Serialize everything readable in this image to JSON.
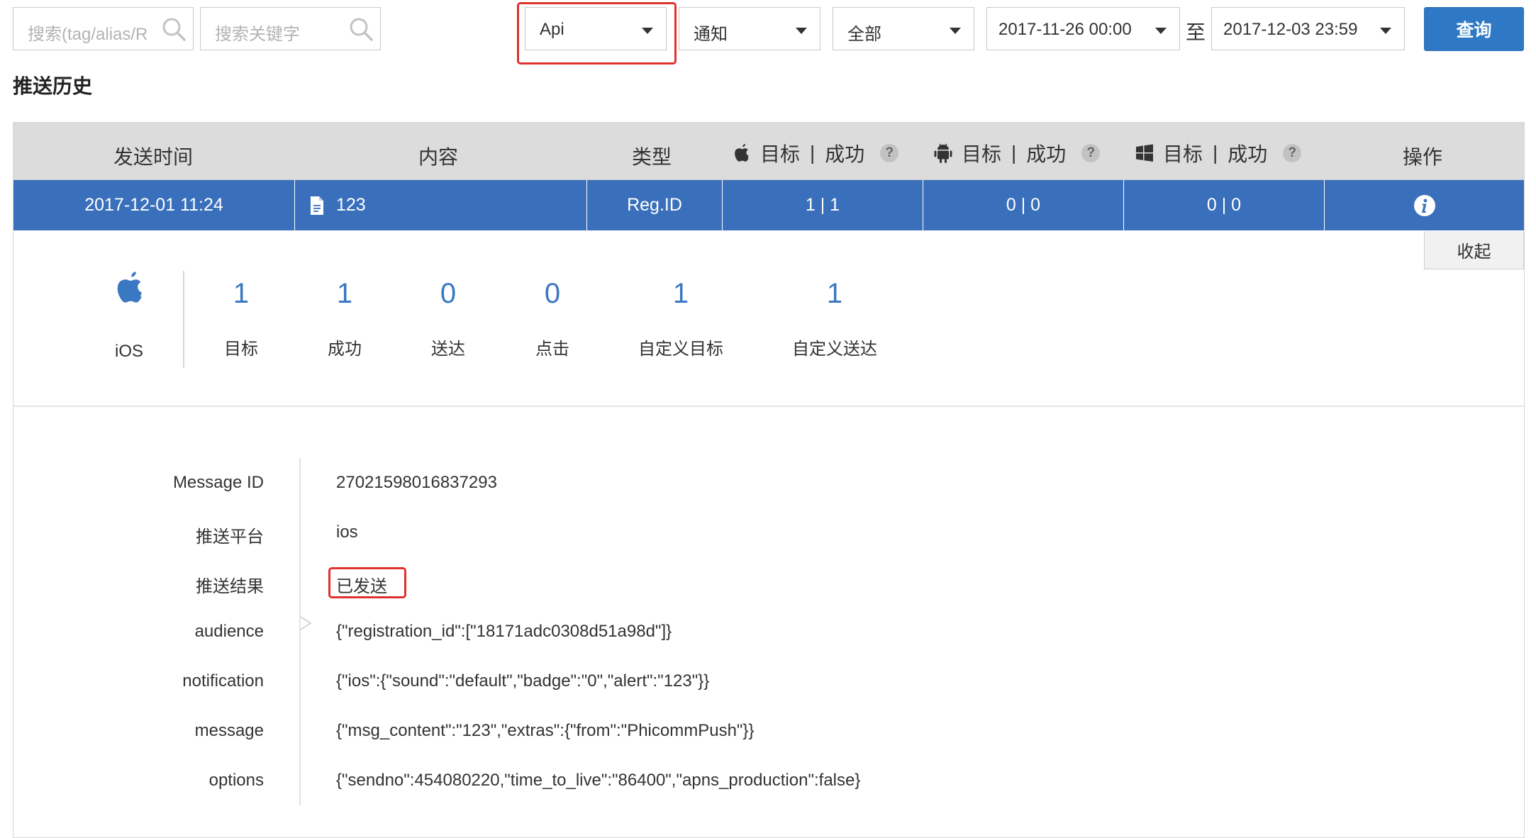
{
  "filters": {
    "search_tag_placeholder": "搜索(tag/alias/R",
    "search_keyword_placeholder": "搜索关键字",
    "source_select": "Api",
    "type_select": "通知",
    "scope_select": "全部",
    "start_time": "2017-11-26 00:00",
    "range_separator": "至",
    "end_time": "2017-12-03 23:59",
    "query_button": "查询"
  },
  "section_title": "推送历史",
  "table": {
    "headers": {
      "send_time": "发送时间",
      "content": "内容",
      "type": "类型",
      "target": "目标",
      "divider": "|",
      "success": "成功",
      "help": "?",
      "action": "操作"
    },
    "row": {
      "send_time": "2017-12-01 11:24",
      "content": "123",
      "type": "Reg.ID",
      "ios": "1 | 1",
      "android": "0 | 0",
      "windows": "0 | 0"
    },
    "collapse_button": "收起"
  },
  "stats": {
    "platform": "iOS",
    "items": [
      {
        "value": "1",
        "label": "目标"
      },
      {
        "value": "1",
        "label": "成功"
      },
      {
        "value": "0",
        "label": "送达"
      },
      {
        "value": "0",
        "label": "点击"
      },
      {
        "value": "1",
        "label": "自定义目标"
      },
      {
        "value": "1",
        "label": "自定义送达"
      }
    ]
  },
  "details": [
    {
      "label": "Message ID",
      "value": "27021598016837293"
    },
    {
      "label": "推送平台",
      "value": "ios"
    },
    {
      "label": "推送结果",
      "value": "已发送"
    },
    {
      "label": "audience",
      "value": "{\"registration_id\":[\"18171adc0308d51a98d\"]}"
    },
    {
      "label": "notification",
      "value": "{\"ios\":{\"sound\":\"default\",\"badge\":\"0\",\"alert\":\"123\"}}"
    },
    {
      "label": "message",
      "value": "{\"msg_content\":\"123\",\"extras\":{\"from\":\"PhicommPush\"}}"
    },
    {
      "label": "options",
      "value": "{\"sendno\":454080220,\"time_to_live\":\"86400\",\"apns_production\":false}"
    }
  ],
  "colors": {
    "accent": "#2f78c6",
    "selected_row": "#3a70bb",
    "highlight_frame": "#e0312e",
    "stat_number": "#3a78c2"
  },
  "icons": [
    "search-icon",
    "apple-icon",
    "android-icon",
    "windows-icon",
    "document-icon",
    "info-icon"
  ]
}
